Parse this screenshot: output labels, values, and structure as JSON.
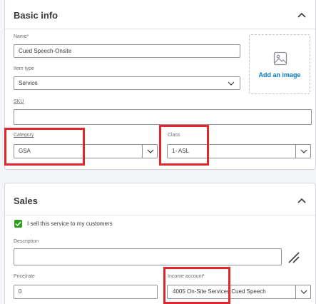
{
  "basic_info": {
    "title": "Basic info",
    "name_label": "Name*",
    "name_value": "Cued Speech-Onsite",
    "item_type_label": "Item type",
    "item_type_value": "Service",
    "sku_label": "SKU",
    "sku_value": "",
    "category_label": "Category",
    "category_value": "GSA",
    "class_label": "Class",
    "class_value": "1- ASL",
    "add_image_label": "Add an image"
  },
  "sales": {
    "title": "Sales",
    "sell_checkbox_label": "I sell this service to my customers",
    "sell_checked": true,
    "description_label": "Description",
    "description_value": "",
    "price_label": "Price/rate",
    "price_value": "0",
    "income_account_label": "Income account*",
    "income_account_value": "4005 On-Site Services:Cued Speech"
  },
  "colors": {
    "highlight": "#e2262b",
    "checkbox": "#2ca01c",
    "link": "#0077c5"
  },
  "icons": [
    "chevron-up-icon",
    "chevron-down-icon",
    "image-placeholder-icon",
    "checkmark-icon",
    "resize-icon"
  ]
}
